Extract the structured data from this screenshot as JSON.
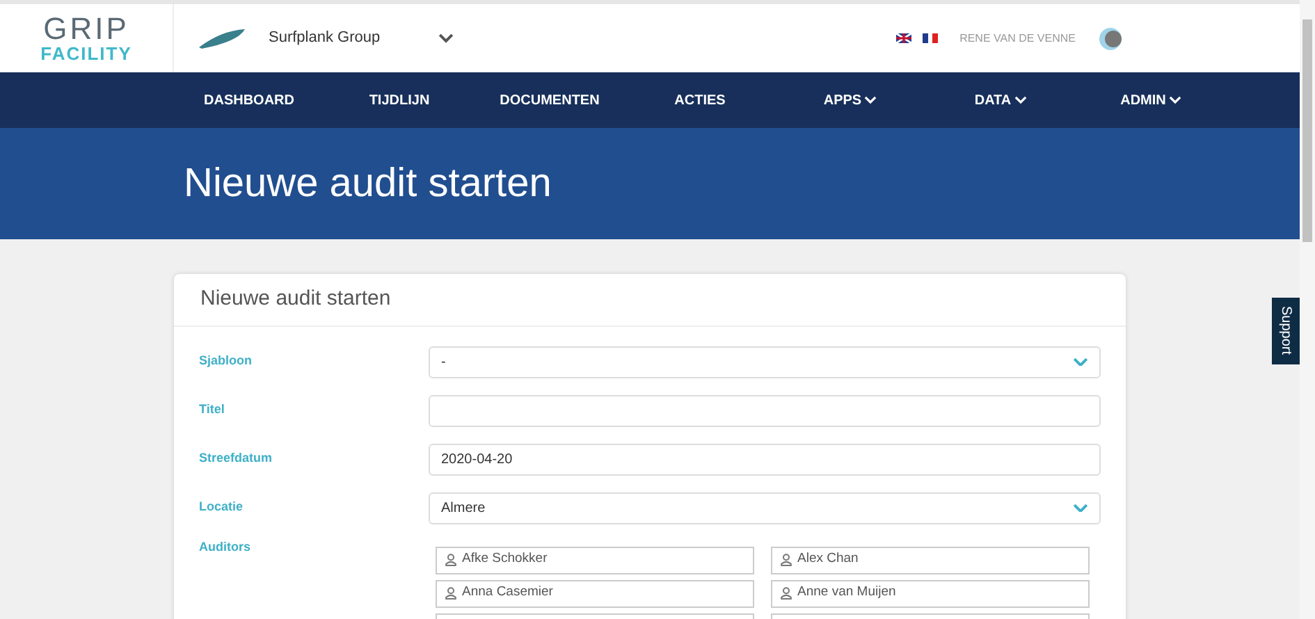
{
  "header": {
    "logo_top": "GRIP",
    "logo_bottom": "FACILITY",
    "company": "Surfplank Group",
    "user": "RENE VAN DE VENNE"
  },
  "nav": [
    {
      "label": "DASHBOARD",
      "dropdown": false
    },
    {
      "label": "TIJDLIJN",
      "dropdown": false
    },
    {
      "label": "DOCUMENTEN",
      "dropdown": false
    },
    {
      "label": "ACTIES",
      "dropdown": false
    },
    {
      "label": "APPS",
      "dropdown": true
    },
    {
      "label": "DATA",
      "dropdown": true
    },
    {
      "label": "ADMIN",
      "dropdown": true
    }
  ],
  "banner": {
    "title": "Nieuwe audit starten"
  },
  "form": {
    "title": "Nieuwe audit starten",
    "fields": [
      {
        "kind": "select",
        "label": "Sjabloon",
        "value": "-"
      },
      {
        "kind": "text",
        "label": "Titel"
      },
      {
        "kind": "text",
        "label": "Streefdatum",
        "value": "2020-04-20"
      },
      {
        "kind": "select",
        "label": "Locatie",
        "value": "Almere"
      }
    ],
    "auditors_label": "Auditors",
    "auditors": [
      "Afke Schokker",
      "Alex Chan",
      "Anna Casemier",
      "Anne van Muijen"
    ]
  },
  "support": "Support"
}
